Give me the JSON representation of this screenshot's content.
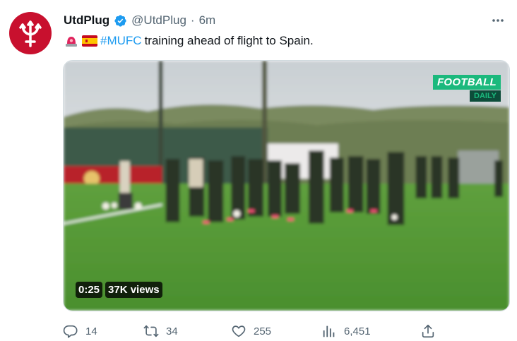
{
  "tweet": {
    "display_name": "UtdPlug",
    "handle": "@UtdPlug",
    "separator": "·",
    "time": "6m",
    "text": {
      "hashtag": "#MUFC",
      "body": "training ahead of flight to Spain."
    },
    "emojis": [
      "siren-emoji",
      "spain-flag-emoji"
    ]
  },
  "media": {
    "type": "video",
    "duration": "0:25",
    "views": "37K views",
    "watermark_top": "FOOTBALL",
    "watermark_bottom": "DAILY"
  },
  "actions": {
    "replies": "14",
    "retweets": "34",
    "likes": "255",
    "views": "6,451"
  },
  "colors": {
    "accent": "#1d9bf0",
    "secondary_text": "#536471",
    "avatar_bg": "#c8102e",
    "watermark_green": "#1bb97d"
  }
}
